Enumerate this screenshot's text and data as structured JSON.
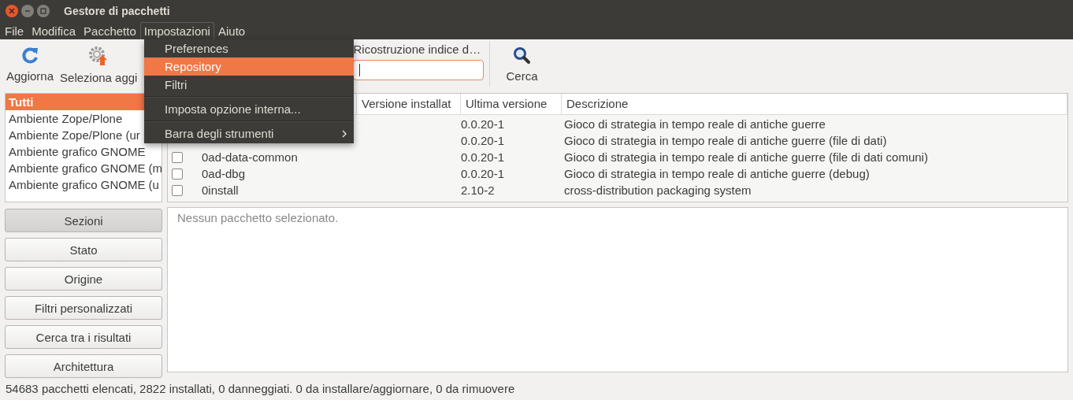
{
  "window": {
    "title": "Gestore di pacchetti"
  },
  "menu_bar": [
    {
      "label": "File",
      "selected": false
    },
    {
      "label": "Modifica",
      "selected": false
    },
    {
      "label": "Pacchetto",
      "selected": false
    },
    {
      "label": "Impostazioni",
      "selected": true
    },
    {
      "label": "Aiuto",
      "selected": false
    }
  ],
  "toolbar": {
    "buttons": [
      {
        "kind": "refresh",
        "label": "Aggiorna"
      },
      {
        "kind": "upgrade",
        "label": "Seleziona aggi"
      }
    ],
    "search": {
      "label": "Ricostruzione indice d…",
      "focused": true
    },
    "search_button": {
      "label": "Cerca"
    }
  },
  "sidebar": {
    "items": [
      {
        "label": "Tutti",
        "selected": true
      },
      {
        "label": "Ambiente Zope/Plone",
        "selected": false
      },
      {
        "label": "Ambiente Zope/Plone (ur",
        "selected": false
      },
      {
        "label": "Ambiente grafico GNOME",
        "selected": false
      },
      {
        "label": "Ambiente grafico GNOME (m",
        "selected": false
      },
      {
        "label": "Ambiente grafico GNOME (u",
        "selected": false
      }
    ],
    "filter_buttons": [
      {
        "label": "Sezioni",
        "selected": true
      },
      {
        "label": "Stato",
        "selected": false
      },
      {
        "label": "Origine",
        "selected": false
      },
      {
        "label": "Filtri personalizzati",
        "selected": false
      },
      {
        "label": "Cerca tra i risultati",
        "selected": false
      },
      {
        "label": "Architettura",
        "selected": false
      }
    ]
  },
  "table": {
    "columns": [
      "Versione installat",
      "Ultima versione",
      "Descrizione"
    ],
    "rows": [
      {
        "latest": "0.0.20-1",
        "description": "Gioco di strategia in tempo reale di antiche guerre"
      },
      {
        "latest": "0.0.20-1",
        "description": "Gioco di strategia in tempo reale di antiche guerre (file di dati)"
      },
      {
        "checked": false,
        "name": "0ad-data-common",
        "latest": "0.0.20-1",
        "description": "Gioco di strategia in tempo reale di antiche guerre  (file di dati comuni)"
      },
      {
        "checked": false,
        "name": "0ad-dbg",
        "latest": "0.0.20-1",
        "description": "Gioco di strategia in tempo reale di antiche guerre (debug)"
      },
      {
        "checked": false,
        "name": "0install",
        "latest": "2.10-2",
        "description": "cross-distribution packaging system"
      }
    ]
  },
  "details": {
    "text": "Nessun pacchetto selezionato."
  },
  "status_bar": "54683 pacchetti elencati, 2822 installati, 0 danneggiati. 0 da installare/aggiornare, 0 da rimuovere",
  "dropdown_menu": {
    "items": [
      {
        "kind": "item",
        "label": "Preferences",
        "selected": false
      },
      {
        "kind": "item",
        "label": "Repository",
        "selected": true
      },
      {
        "kind": "item",
        "label": "Filtri",
        "selected": false
      },
      {
        "kind": "separator"
      },
      {
        "kind": "item",
        "label": "Imposta opzione interna...",
        "selected": false
      },
      {
        "kind": "separator"
      },
      {
        "kind": "submenu",
        "label": "Barra degli strumenti",
        "selected": false
      }
    ]
  }
}
